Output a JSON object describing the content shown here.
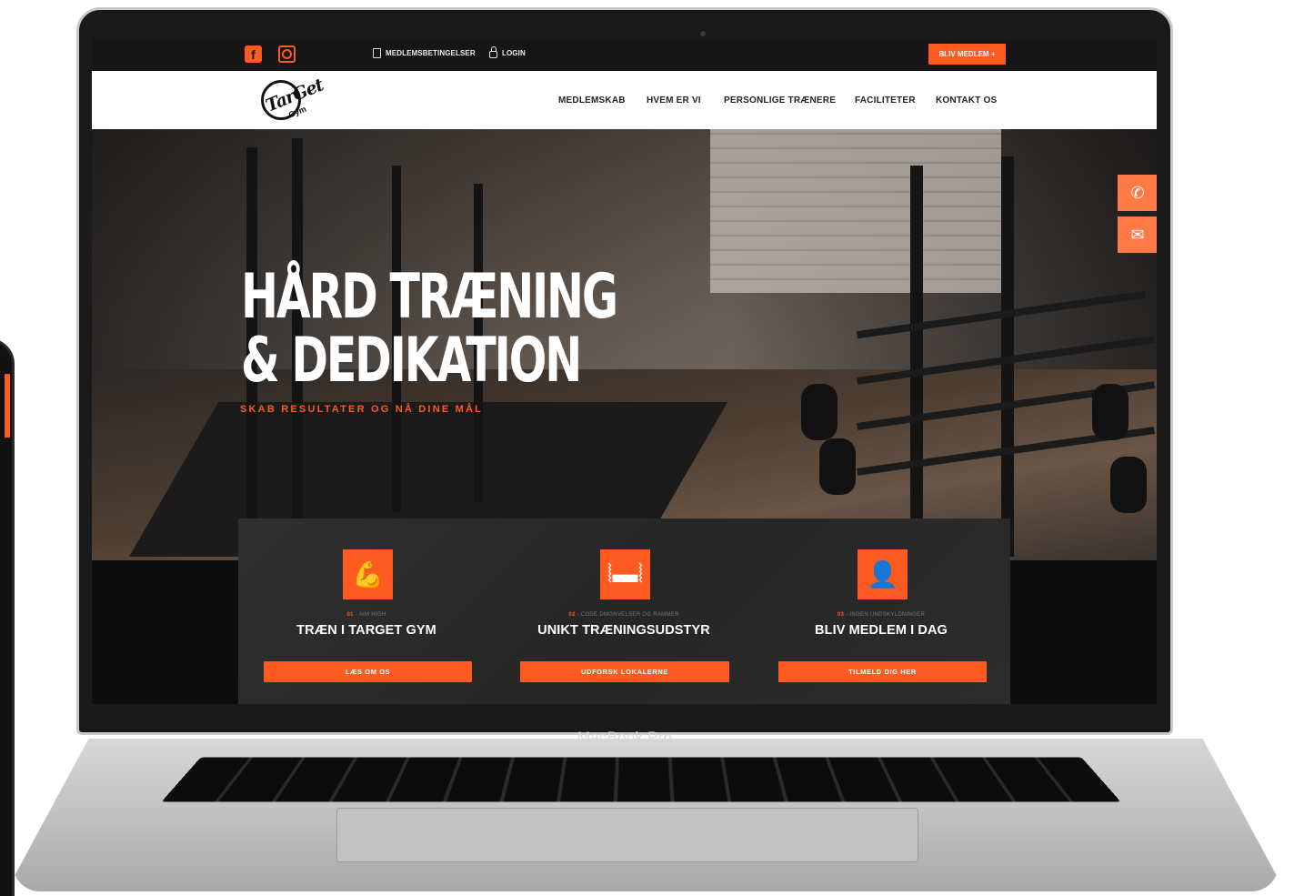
{
  "device": {
    "label": "MacBook Pro"
  },
  "topbar": {
    "social": [
      {
        "name": "facebook",
        "icon": "facebook-icon"
      },
      {
        "name": "instagram",
        "icon": "instagram-icon"
      }
    ],
    "links": {
      "terms": "MEDLEMSBETINGELSER",
      "login": "LOGIN"
    },
    "join_button": "BLIV MEDLEM +"
  },
  "navbar": {
    "logo": {
      "word": "TarGet",
      "sub": "Gym"
    },
    "items": [
      "MEDLEMSKAB",
      "HVEM ER VI",
      "PERSONLIGE TRÆNERE",
      "FACILITETER",
      "KONTAKT OS"
    ]
  },
  "hero": {
    "title_line1": "HÅRD TRÆNING",
    "title_line2": "& DEDIKATION",
    "subtitle": "SKAB RESULTATER OG NÅ DINE MÅL"
  },
  "cards": [
    {
      "num": "01",
      "tag": " - AIM HIGH",
      "title": "TRÆN I TARGET GYM",
      "button": "LÆS OM OS",
      "icon": "flexing-body-icon"
    },
    {
      "num": "02",
      "tag": " - CODE DMGNVELSER OG RAMMER",
      "title": "UNIKT TRÆNINGSUDSTYR",
      "button": "UDFORSK LOKALERNE",
      "icon": "dumbbell-icon"
    },
    {
      "num": "03",
      "tag": " - INGEN UNDSKYLDNINGER",
      "title": "BLIV MEDLEM I DAG",
      "button": "TILMELD DIG HER",
      "icon": "add-user-icon"
    }
  ],
  "floating": [
    {
      "name": "phone",
      "icon": "phone-icon"
    },
    {
      "name": "mail",
      "icon": "mail-icon"
    }
  ],
  "colors": {
    "accent": "#ff5a1f",
    "dark": "#161616",
    "card": "#2b2b2b",
    "white": "#ffffff"
  }
}
